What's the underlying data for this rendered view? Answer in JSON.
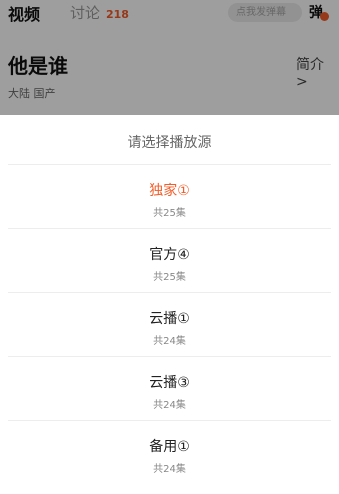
{
  "tabs": {
    "video": "视频",
    "discuss": "讨论",
    "discuss_count": "218"
  },
  "danmu": {
    "placeholder": "点我发弹幕",
    "toggle_label": "弹"
  },
  "show": {
    "title": "他是谁",
    "meta": "大陆  国产",
    "intro": "简介 >"
  },
  "sheet": {
    "title": "请选择播放源",
    "sources": [
      {
        "name": "独家①",
        "episodes": "共25集",
        "selected": true
      },
      {
        "name": "官方④",
        "episodes": "共25集",
        "selected": false
      },
      {
        "name": "云播①",
        "episodes": "共24集",
        "selected": false
      },
      {
        "name": "云播③",
        "episodes": "共24集",
        "selected": false
      },
      {
        "name": "备用①",
        "episodes": "共24集",
        "selected": false
      }
    ]
  },
  "colors": {
    "accent": "#f25d2a",
    "overlay": "rgba(0,0,0,0.38)"
  }
}
